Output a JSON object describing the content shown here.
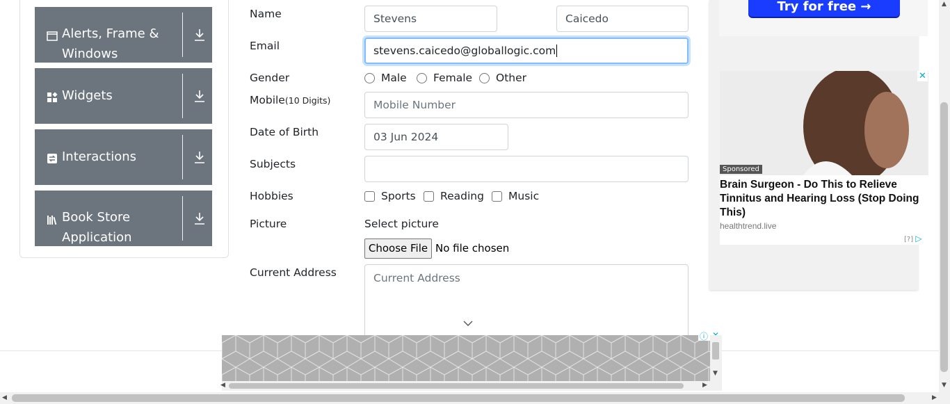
{
  "sidebar": {
    "groups": [
      {
        "label": "Alerts, Frame & Windows",
        "icon": "window-icon"
      },
      {
        "label": "Widgets",
        "icon": "widgets-icon"
      },
      {
        "label": "Interactions",
        "icon": "interactions-icon"
      },
      {
        "label": "Book Store Application",
        "icon": "book-store-icon"
      }
    ]
  },
  "form": {
    "name_label": "Name",
    "first_name": "Stevens",
    "last_name": "Caicedo",
    "email_label": "Email",
    "email_value": "stevens.caicedo@globallogic.com",
    "gender_label": "Gender",
    "gender_options": [
      "Male",
      "Female",
      "Other"
    ],
    "mobile_label": "Mobile",
    "mobile_hint": "(10 Digits)",
    "mobile_placeholder": "Mobile Number",
    "dob_label": "Date of Birth",
    "dob_value": "03 Jun 2024",
    "subjects_label": "Subjects",
    "hobbies_label": "Hobbies",
    "hobby_options": [
      "Sports",
      "Reading",
      "Music"
    ],
    "picture_label": "Picture",
    "select_picture": "Select picture",
    "choose_file": "Choose File",
    "no_file": "No file chosen",
    "address_label": "Current Address",
    "address_placeholder": "Current Address"
  },
  "ad": {
    "top_button": "Try for free →",
    "sponsored": "Sponsored",
    "headline": "Brain Surgeon - Do This to Relieve Tinnitus and Hearing Loss (Stop Doing This)",
    "domain": "healthtrend.live",
    "info": "[?]"
  },
  "colors": {
    "group_bg": "#6c757d",
    "focus_border": "#80bdff",
    "ad_accent": "#00aecd",
    "ad_button": "#1a3cff"
  }
}
